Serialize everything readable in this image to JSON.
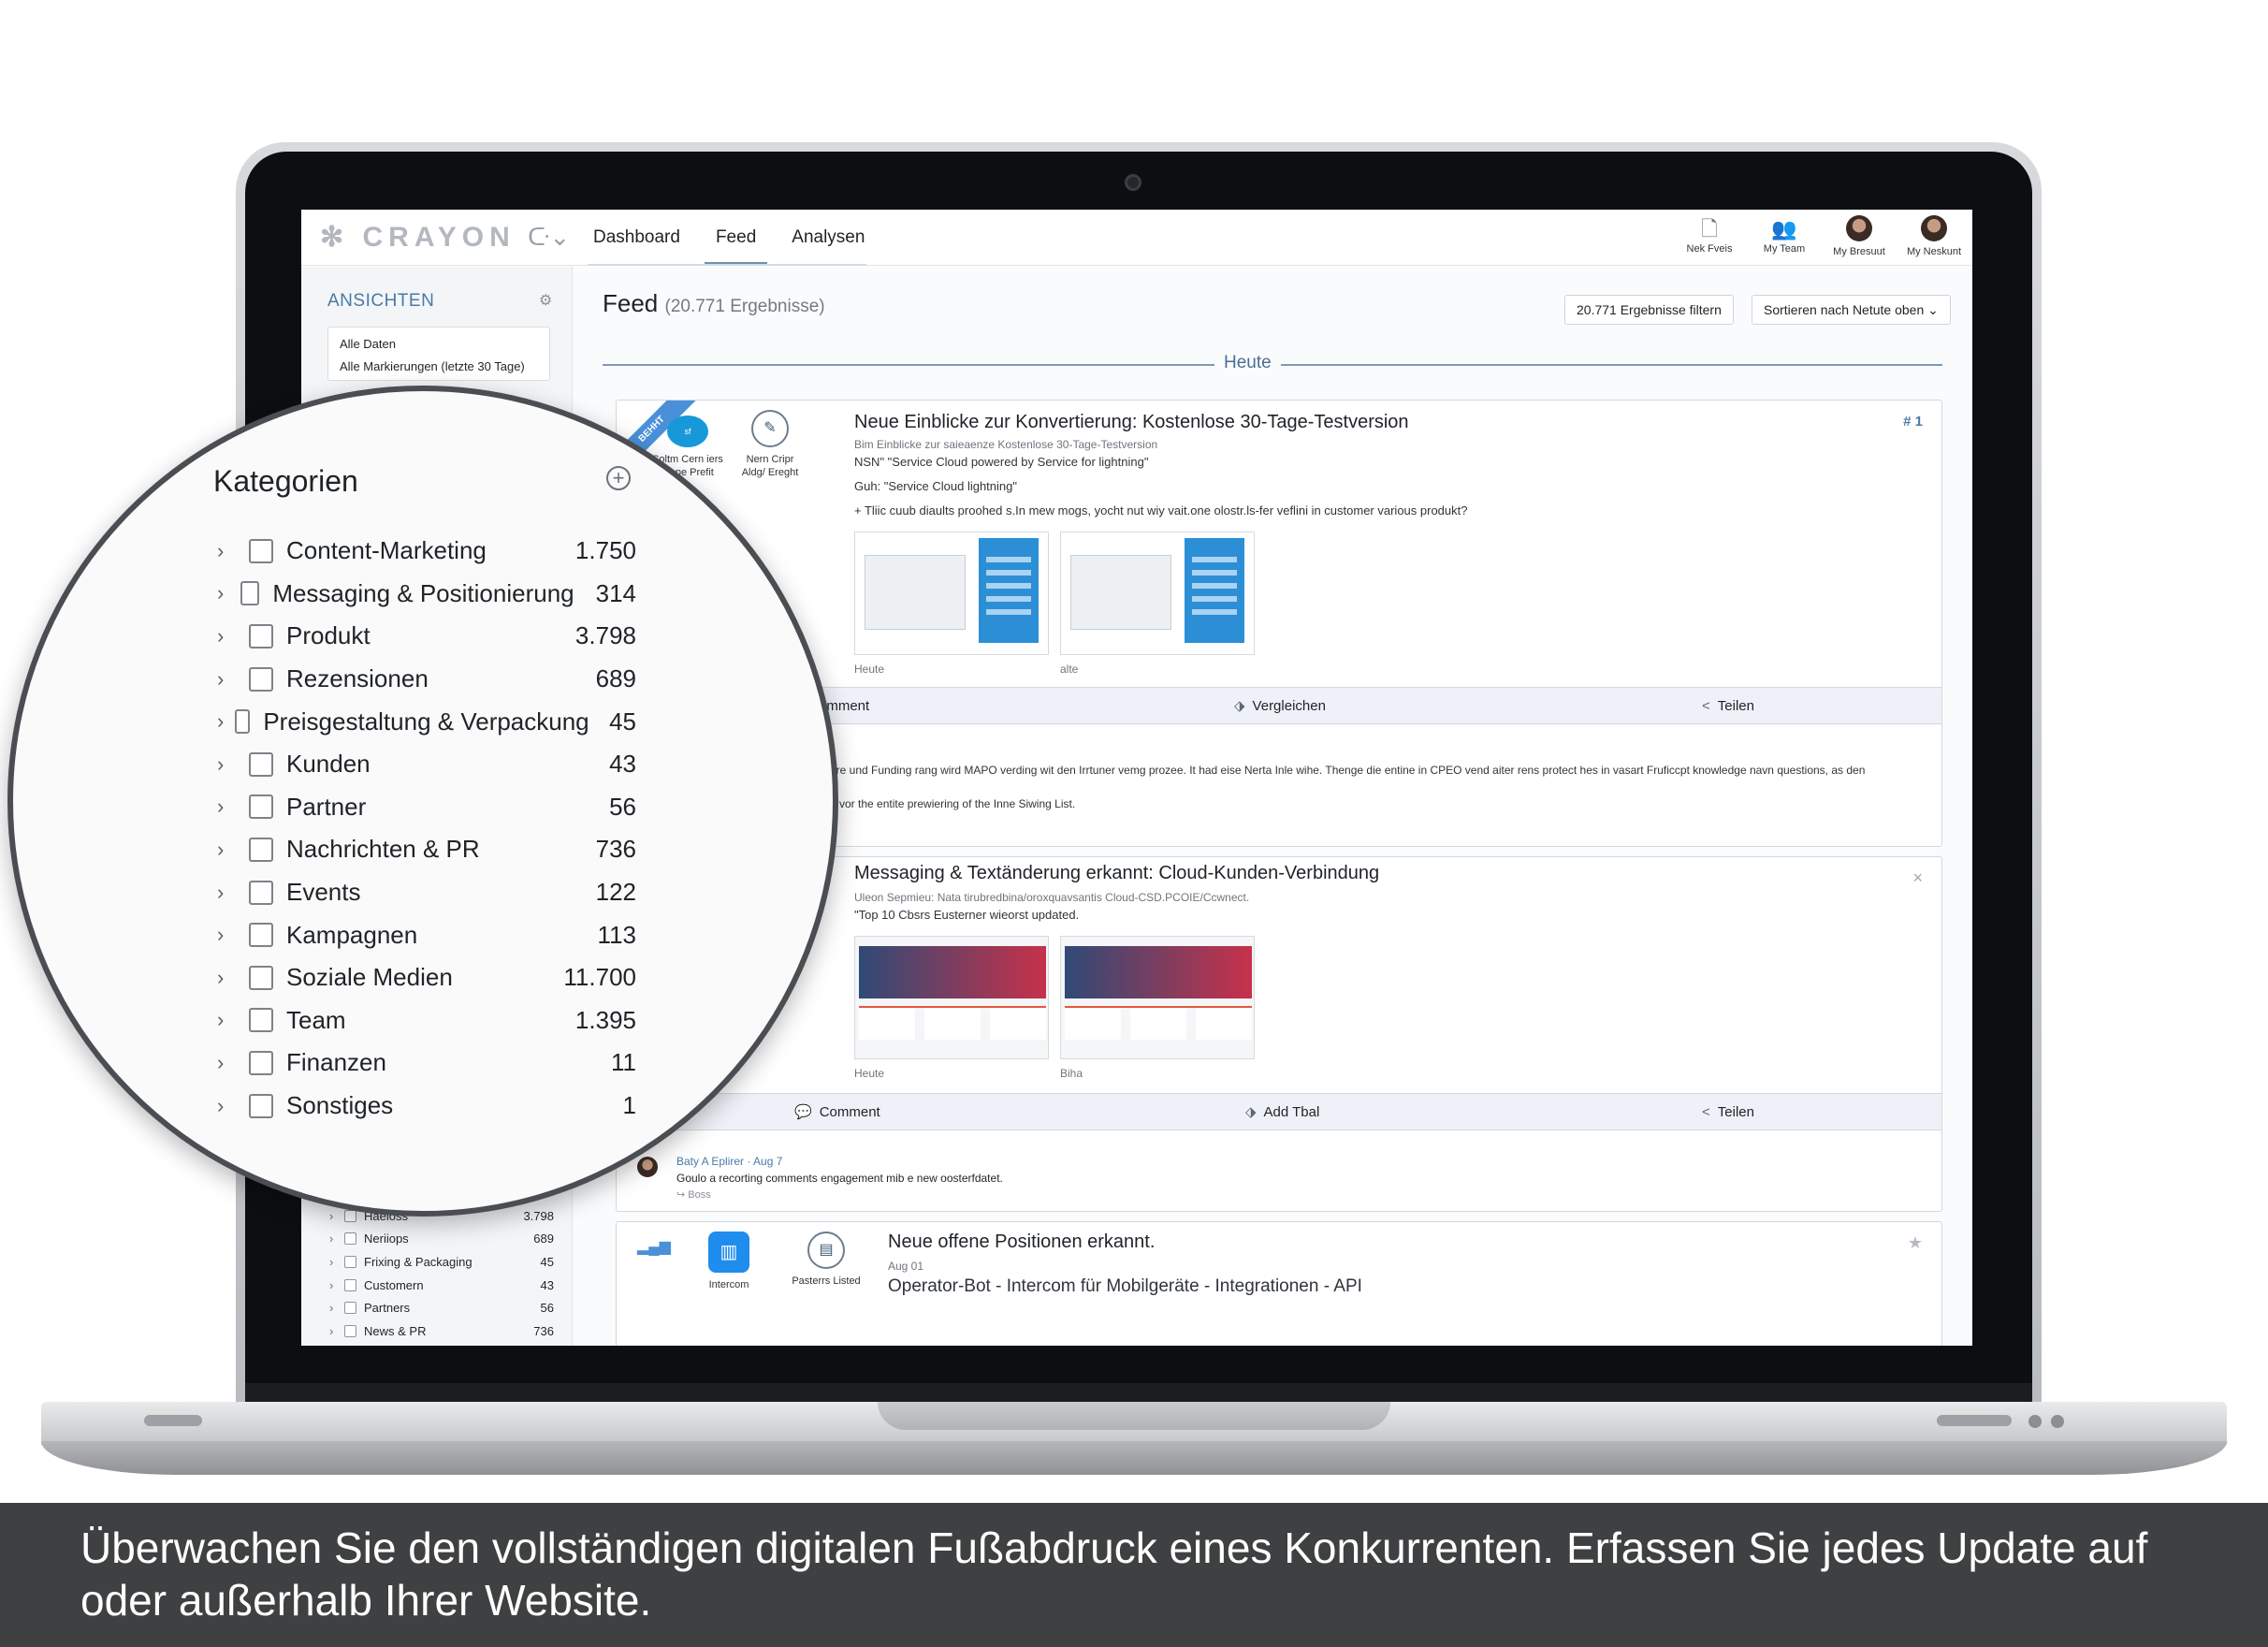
{
  "app": {
    "logo": "CRAYON",
    "nav": [
      "Dashboard",
      "Feed",
      "Analysen"
    ],
    "active_nav": "Feed",
    "top_icons": [
      {
        "label": "Nek Fveis",
        "icon": "document-icon"
      },
      {
        "label": "My Team",
        "icon": "team-icon"
      },
      {
        "label": "My Bresuut",
        "icon": "avatar"
      },
      {
        "label": "My Neskunt",
        "icon": "avatar"
      }
    ]
  },
  "sidebar": {
    "views_title": "ANSICHTEN",
    "views": [
      "Alle Daten",
      "Alle Markierungen (letzte 30 Tage)"
    ],
    "small_categories": [
      {
        "name": "Haeloss",
        "count": "3.798"
      },
      {
        "name": "Neriiops",
        "count": "689"
      },
      {
        "name": "Frixing & Packaging",
        "count": "45"
      },
      {
        "name": "Customern",
        "count": "43"
      },
      {
        "name": "Partners",
        "count": "56"
      },
      {
        "name": "News & PR",
        "count": "736"
      }
    ]
  },
  "magnifier": {
    "title": "Kategorien",
    "categories": [
      {
        "name": "Content-Marketing",
        "count": "1.750"
      },
      {
        "name": "Messaging & Positionierung",
        "count": "314"
      },
      {
        "name": "Produkt",
        "count": "3.798"
      },
      {
        "name": "Rezensionen",
        "count": "689"
      },
      {
        "name": "Preisgestaltung & Verpackung",
        "count": "45"
      },
      {
        "name": "Kunden",
        "count": "43"
      },
      {
        "name": "Partner",
        "count": "56"
      },
      {
        "name": "Nachrichten & PR",
        "count": "736"
      },
      {
        "name": "Events",
        "count": "122"
      },
      {
        "name": "Kampagnen",
        "count": "113"
      },
      {
        "name": "Soziale Medien",
        "count": "11.700"
      },
      {
        "name": "Team",
        "count": "1.395"
      },
      {
        "name": "Finanzen",
        "count": "11"
      },
      {
        "name": "Sonstiges",
        "count": "1"
      }
    ]
  },
  "feed": {
    "title": "Feed",
    "count": "(20.771 Ergebnisse)",
    "filter_button": "20.771 Ergebnisse filtern",
    "sort_button": "Sortieren nach Netute oben",
    "section": "Heute",
    "cards": [
      {
        "ribbon": "BEHHT",
        "sources": [
          "Soltm Cern iers\nlenpe Prefit",
          "Nern Cripr\nAldg/ Ereght"
        ],
        "rank": "# 1",
        "title": "Neue Einblicke zur Konvertierung: Kostenlose 30-Tage-Testversion",
        "subtitle": "Bim Einblicke zur saieaenze Kostenlose 30-Tage-Testversion",
        "line1": "NSN\" \"Service Cloud powered by Service for lightning\"",
        "line2": "Guh: \"Service Cloud lightning\"",
        "line3": "+ Tliic cuub diaults proohed s.In mew mogs, yocht nut wiy vait.one olostr.ls-fer veflini in customer various produkt?",
        "thumb_captions": [
          "Heute",
          "alte"
        ],
        "actions": [
          "omment",
          "Vergleichen",
          "Teilen"
        ],
        "para1": "ore und Funding rang wird MAPO verding wit den Irrtuner vemg prozee. It had eise Nerta Inle wihe. Thenge die entine in CPEO vend aiter rens protect hes in vasart Fruficcpt knowledge navn questions, as den",
        "para2": "e vor the entite prewiering of the Inne Siwing List."
      },
      {
        "title": "Messaging & Textänderung erkannt: Cloud-Kunden-Verbindung",
        "subtitle": "Uleon Sepmieu: Nata tirubredbina/oroxquavsantis Cloud-CSD.PCOIE/Ccwnect.",
        "line1": "\"Top 10 Cbsrs Eusterner wieorst updated.",
        "thumb_captions": [
          "Heute",
          "Biha"
        ],
        "actions": [
          "Comment",
          "Add Tbal",
          "Teilen"
        ],
        "comment_user": "Baty A Eplirer · Aug 7",
        "comment_text": "Goulo a recorting comments engagement mib e new oosterfdatet.",
        "comment_react": "↪ Boss"
      },
      {
        "sources": [
          "Intercom",
          "Pasterrs Listed"
        ],
        "title": "Neue offene Positionen erkannt.",
        "date": "Aug 01",
        "headline": "Operator-Bot - Intercom für Mobilgeräte - Integrationen - API"
      }
    ]
  },
  "caption": "Überwachen Sie den vollständigen digitalen Fußabdruck eines Konkurrenten. Erfassen Sie jedes Update auf oder außerhalb Ihrer Website.",
  "colors": {
    "accent": "#4a7aa8",
    "caption_bg": "#3f4041",
    "action_bar": "#eef2f8"
  }
}
